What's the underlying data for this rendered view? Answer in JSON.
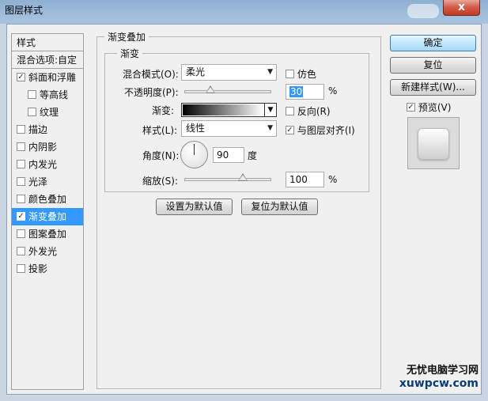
{
  "window": {
    "title": "图层样式",
    "close_glyph": "x"
  },
  "style_list": {
    "header": "样式",
    "blend_options": "混合选项:自定",
    "items": [
      {
        "label": "斜面和浮雕",
        "checked": true,
        "indent": false,
        "selected": false
      },
      {
        "label": "等高线",
        "checked": false,
        "indent": true,
        "selected": false
      },
      {
        "label": "纹理",
        "checked": false,
        "indent": true,
        "selected": false
      },
      {
        "label": "描边",
        "checked": false,
        "indent": false,
        "selected": false
      },
      {
        "label": "内阴影",
        "checked": false,
        "indent": false,
        "selected": false
      },
      {
        "label": "内发光",
        "checked": false,
        "indent": false,
        "selected": false
      },
      {
        "label": "光泽",
        "checked": false,
        "indent": false,
        "selected": false
      },
      {
        "label": "颜色叠加",
        "checked": false,
        "indent": false,
        "selected": false
      },
      {
        "label": "渐变叠加",
        "checked": true,
        "indent": false,
        "selected": true
      },
      {
        "label": "图案叠加",
        "checked": false,
        "indent": false,
        "selected": false
      },
      {
        "label": "外发光",
        "checked": false,
        "indent": false,
        "selected": false
      },
      {
        "label": "投影",
        "checked": false,
        "indent": false,
        "selected": false
      }
    ]
  },
  "panel": {
    "group_title": "渐变叠加",
    "sub_title": "渐变",
    "blend_mode": {
      "label": "混合模式(O):",
      "value": "柔光"
    },
    "dither": {
      "label": "仿色",
      "checked": false
    },
    "opacity": {
      "label": "不透明度(P):",
      "value": "30",
      "unit": "%",
      "level": 0.3
    },
    "gradient": {
      "label": "渐变:",
      "from": "#000000",
      "to": "#ffffff"
    },
    "reverse": {
      "label": "反向(R)",
      "checked": false
    },
    "style": {
      "label": "样式(L):",
      "value": "线性"
    },
    "align": {
      "label": "与图层对齐(I)",
      "checked": true
    },
    "angle": {
      "label": "角度(N):",
      "value": "90",
      "unit": "度"
    },
    "scale": {
      "label": "缩放(S):",
      "value": "100",
      "unit": "%",
      "level": 0.67
    },
    "set_default": "设置为默认值",
    "reset_default": "复位为默认值"
  },
  "right": {
    "ok": "确定",
    "reset": "复位",
    "new_style": "新建样式(W)...",
    "preview": {
      "label": "预览(V)",
      "checked": true
    }
  },
  "watermark": {
    "line1": "无忧电脑学习网",
    "line2": "xuwpcw.com"
  },
  "colors": {
    "selection": "#3399ff",
    "titlebar": "#9dbbd9",
    "close": "#c23b22"
  }
}
